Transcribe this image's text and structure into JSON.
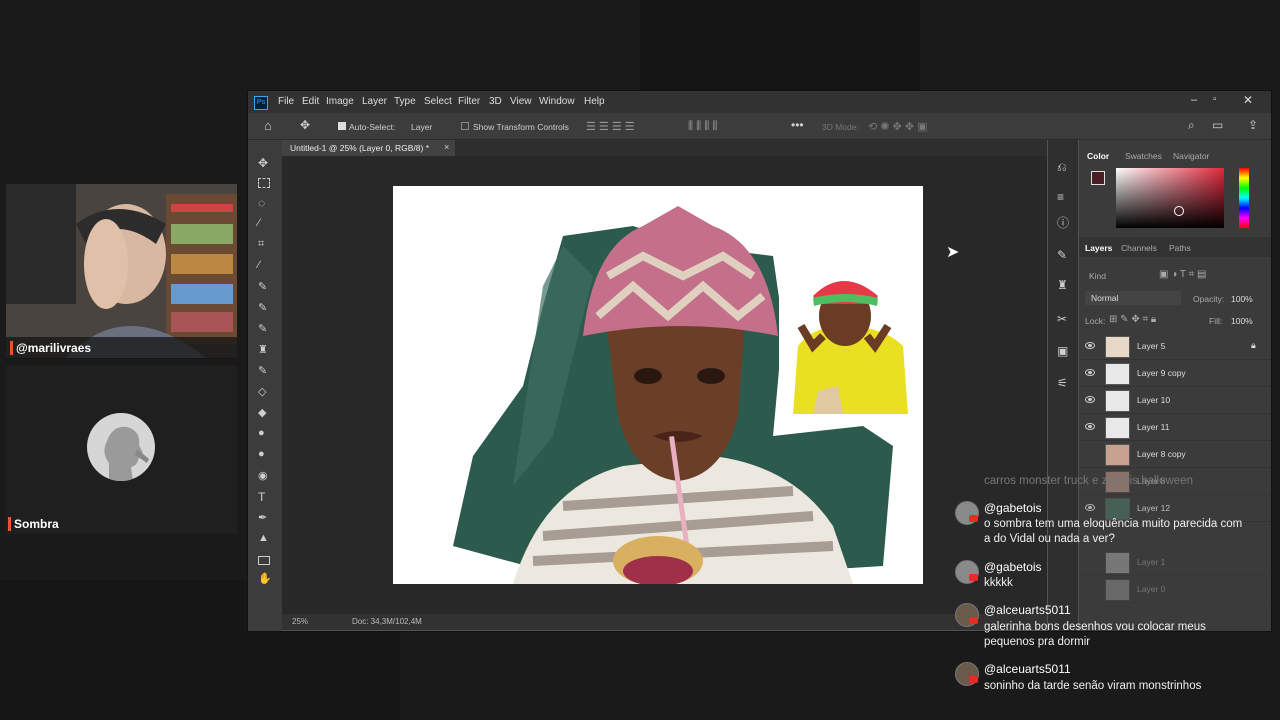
{
  "streamer": {
    "cam_handle": "@marilivraes",
    "guest_name": "Sombra"
  },
  "photoshop": {
    "menu": [
      "File",
      "Edit",
      "Image",
      "Layer",
      "Type",
      "Select",
      "Filter",
      "3D",
      "View",
      "Window",
      "Help"
    ],
    "options": {
      "auto_select_label": "Auto-Select:",
      "auto_select_value": "Layer",
      "transform_label": "Show Transform Controls",
      "mode_3d": "3D Mode:"
    },
    "document_tab": "Untitled-1 @ 25% (Layer 0, RGB/8) *",
    "status": {
      "zoom": "25%",
      "doc": "Doc: 34,3M/102,4M"
    },
    "color_panel": {
      "tabs": [
        "Color",
        "Swatches",
        "Navigator"
      ],
      "foreground": "#4a1f24"
    },
    "layers_panel": {
      "tabs": [
        "Layers",
        "Channels",
        "Paths"
      ],
      "filter": "Kind",
      "blend_mode": "Normal",
      "opacity_label": "Opacity:",
      "opacity_value": "100%",
      "lock_label": "Lock:",
      "fill_label": "Fill:",
      "fill_value": "100%",
      "layers": [
        "Layer 5",
        "Layer 9 copy",
        "Layer 10",
        "Layer 11",
        "Layer 8 copy",
        "Layer 8",
        "Layer 12",
        "Layer 1",
        "Layer 0"
      ]
    }
  },
  "chat": {
    "ghost_text": "carros monster truck e zumbis halloween",
    "messages": [
      {
        "user": "@gabetois",
        "text": "o sombra tem uma eloquência muito parecida com a do Vidal ou nada a ver?"
      },
      {
        "user": "@gabetois",
        "text": "kkkkk"
      },
      {
        "user": "@alceuarts5011",
        "text": "galerinha bons desenhos vou colocar meus pequenos pra dormir"
      },
      {
        "user": "@alceuarts5011",
        "text": "soninho da tarde senão viram monstrinhos"
      }
    ]
  },
  "colors": {
    "accent": "#e8542c",
    "ps_bg": "#535353",
    "painting_green": "#2c5a4c"
  }
}
